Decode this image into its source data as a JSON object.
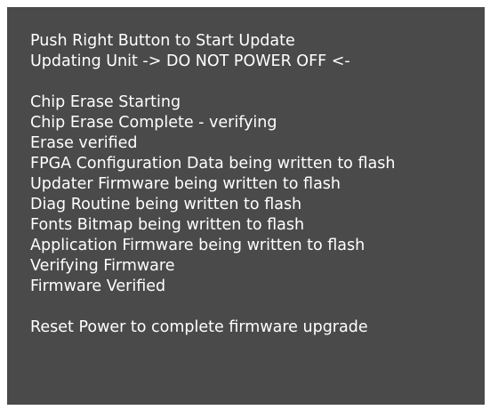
{
  "colors": {
    "background": "#4a4a4a",
    "text": "#ffffff",
    "page": "#ffffff"
  },
  "console": {
    "header": [
      "Push Right Button to Start Update",
      "Updating Unit -> DO NOT POWER OFF <-"
    ],
    "progress": [
      "Chip Erase Starting",
      "Chip Erase Complete - verifying",
      "Erase verified",
      "FPGA Configuration Data being written to flash",
      "Updater Firmware being written to flash",
      "Diag Routine being written to flash",
      "Fonts Bitmap being written to flash",
      "Application Firmware being written to flash",
      "Verifying Firmware",
      "Firmware Verified"
    ],
    "footer": [
      "Reset Power to complete firmware upgrade"
    ]
  }
}
